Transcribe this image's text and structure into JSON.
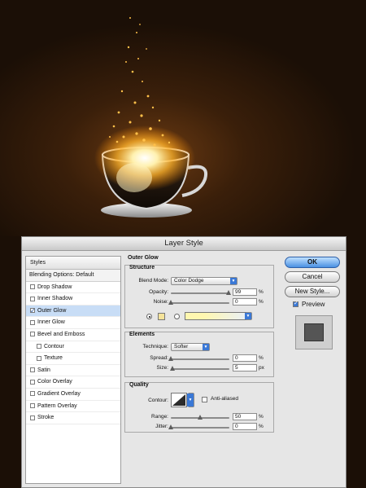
{
  "colors": {
    "background": "#1b0f06",
    "glow": "#ffb028",
    "selection": "#c8ddf6",
    "accent": "#3a78d6",
    "glow_swatch": "#f5e39a"
  },
  "dialog": {
    "title": "Layer Style",
    "styles_header": "Styles",
    "blending_options": "Blending Options: Default",
    "style_items": [
      {
        "label": "Drop Shadow",
        "checked": false,
        "sub": false
      },
      {
        "label": "Inner Shadow",
        "checked": false,
        "sub": false
      },
      {
        "label": "Outer Glow",
        "checked": true,
        "sub": false,
        "selected": true
      },
      {
        "label": "Inner Glow",
        "checked": false,
        "sub": false
      },
      {
        "label": "Bevel and Emboss",
        "checked": false,
        "sub": false
      },
      {
        "label": "Contour",
        "checked": false,
        "sub": true
      },
      {
        "label": "Texture",
        "checked": false,
        "sub": true
      },
      {
        "label": "Satin",
        "checked": false,
        "sub": false
      },
      {
        "label": "Color Overlay",
        "checked": false,
        "sub": false
      },
      {
        "label": "Gradient Overlay",
        "checked": false,
        "sub": false
      },
      {
        "label": "Pattern Overlay",
        "checked": false,
        "sub": false
      },
      {
        "label": "Stroke",
        "checked": false,
        "sub": false
      }
    ],
    "panel_title": "Outer Glow",
    "structure": {
      "label": "Structure",
      "blend_mode_label": "Blend Mode:",
      "blend_mode_value": "Color Dodge",
      "opacity_label": "Opacity:",
      "opacity_value": "99",
      "opacity_unit": "%",
      "noise_label": "Noise:",
      "noise_value": "0",
      "noise_unit": "%"
    },
    "elements": {
      "label": "Elements",
      "technique_label": "Technique:",
      "technique_value": "Softer",
      "spread_label": "Spread:",
      "spread_value": "0",
      "spread_unit": "%",
      "size_label": "Size:",
      "size_value": "5",
      "size_unit": "px"
    },
    "quality": {
      "label": "Quality",
      "contour_label": "Contour:",
      "anti_aliased_label": "Anti-aliased",
      "range_label": "Range:",
      "range_value": "50",
      "range_unit": "%",
      "jitter_label": "Jitter:",
      "jitter_value": "0",
      "jitter_unit": "%"
    },
    "buttons": {
      "ok": "OK",
      "cancel": "Cancel",
      "new_style": "New Style...",
      "preview": "Preview"
    }
  }
}
